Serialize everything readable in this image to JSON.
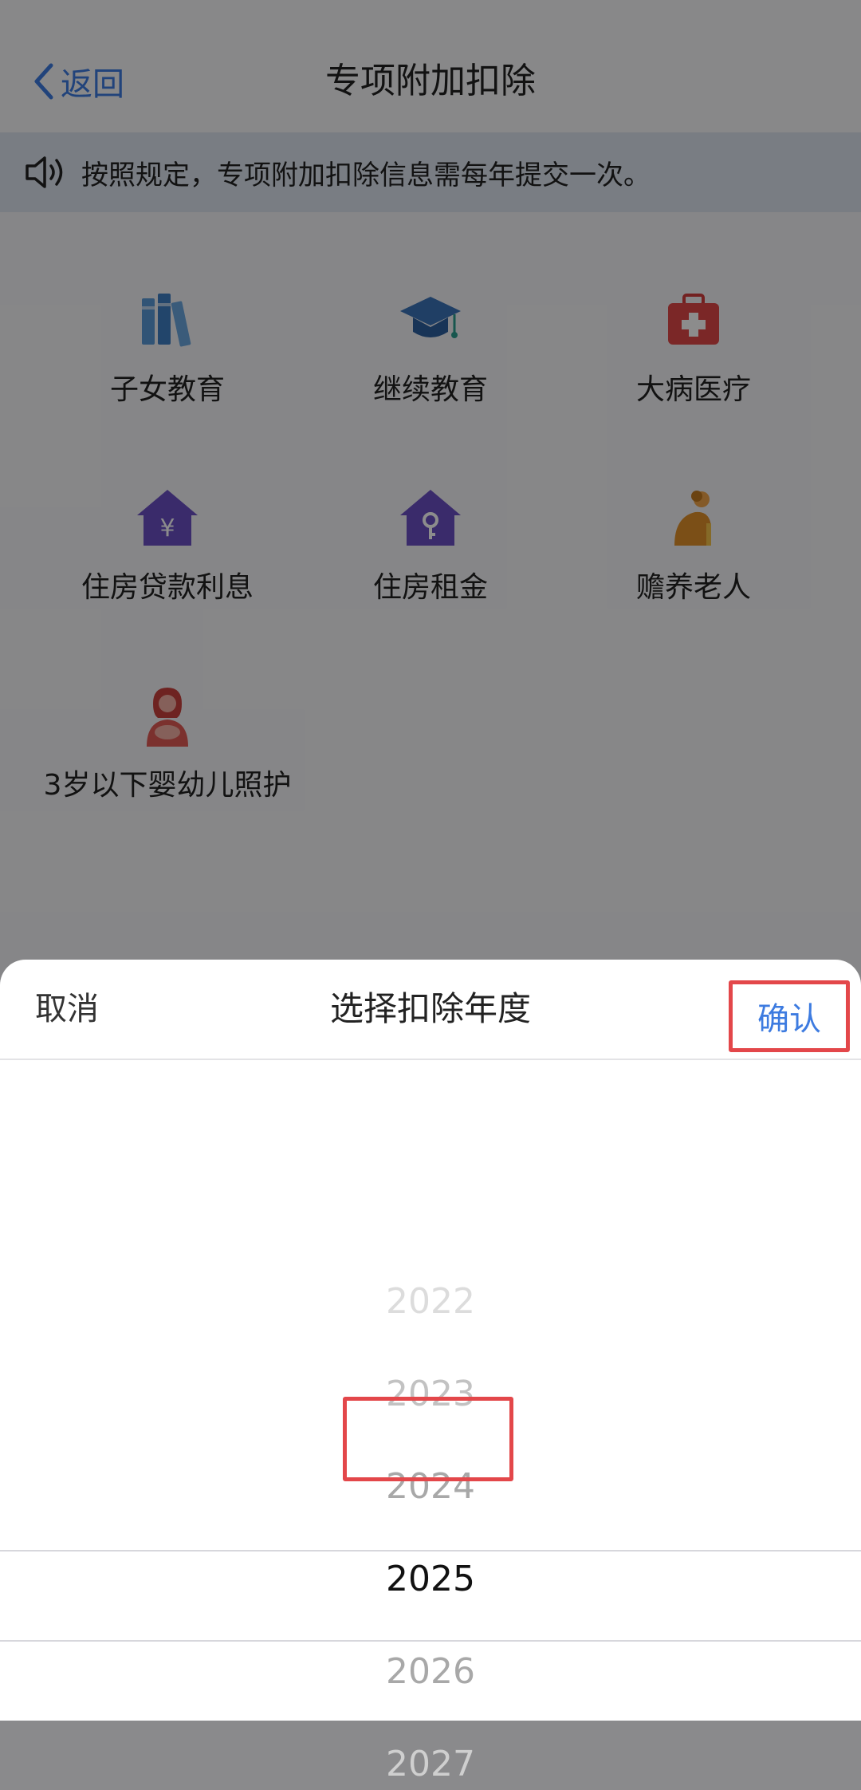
{
  "navbar": {
    "back_label": "返回",
    "title": "专项附加扣除"
  },
  "notice": {
    "text": "按照规定，专项附加扣除信息需每年提交一次。"
  },
  "categories": [
    {
      "label": "子女教育",
      "icon": "books-icon",
      "color": "#4a8fd2"
    },
    {
      "label": "继续教育",
      "icon": "graduation-cap-icon",
      "color": "#3b73b8"
    },
    {
      "label": "大病医疗",
      "icon": "medical-kit-icon",
      "color": "#e04848"
    },
    {
      "label": "住房贷款利息",
      "icon": "house-yen-icon",
      "color": "#6b4fc4"
    },
    {
      "label": "住房租金",
      "icon": "house-key-icon",
      "color": "#6b4fc4"
    },
    {
      "label": "赡养老人",
      "icon": "elderly-person-icon",
      "color": "#e0902a"
    },
    {
      "label": "3岁以下婴幼儿照护",
      "icon": "mother-baby-icon",
      "color": "#e05a55"
    }
  ],
  "sheet": {
    "cancel_label": "取消",
    "title": "选择扣除年度",
    "confirm_label": "确认",
    "years": [
      "2022",
      "2023",
      "2024",
      "2025",
      "2026",
      "2027"
    ],
    "selected_year": "2025"
  },
  "colors": {
    "accent_blue": "#3d7be0",
    "highlight_red": "#e3474a"
  }
}
